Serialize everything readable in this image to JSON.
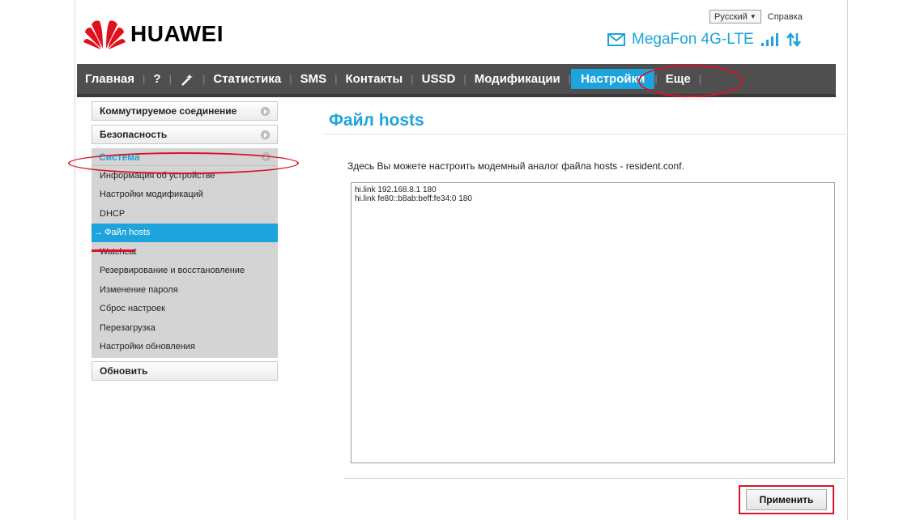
{
  "header": {
    "language": "Русский",
    "help": "Справка",
    "brand": "HUAWEI",
    "operator": "MegaFon 4G-LTE"
  },
  "nav": {
    "items": [
      "Главная",
      "?",
      "Статистика",
      "SMS",
      "Контакты",
      "USSD",
      "Модификации",
      "Настройки",
      "Еще"
    ],
    "active": "Настройки"
  },
  "sidebar": {
    "sections": [
      "Коммутируемое соединение",
      "Безопасность"
    ],
    "group_title": "Система",
    "sub_items": [
      "Информация об устройстве",
      "Настройки модификаций",
      "DHCP",
      "Файл hosts",
      "Watchcat",
      "Резервирование и восстановление",
      "Изменение пароля",
      "Сброс настроек",
      "Перезагрузка",
      "Настройки обновления"
    ],
    "active_arrow": "→",
    "refresh": "Обновить"
  },
  "main": {
    "title": "Файл hosts",
    "description": "Здесь Вы можете настроить модемный аналог файла hosts - resident.conf.",
    "hosts_content": "hi.link 192.168.8.1 180\nhi.link fe80::b8ab:beff:fe34:0 180",
    "apply_label": "Применить"
  },
  "colors": {
    "accent": "#1ea4dc",
    "nav_bg": "#4f4f4f",
    "highlight": "#d8132b"
  }
}
